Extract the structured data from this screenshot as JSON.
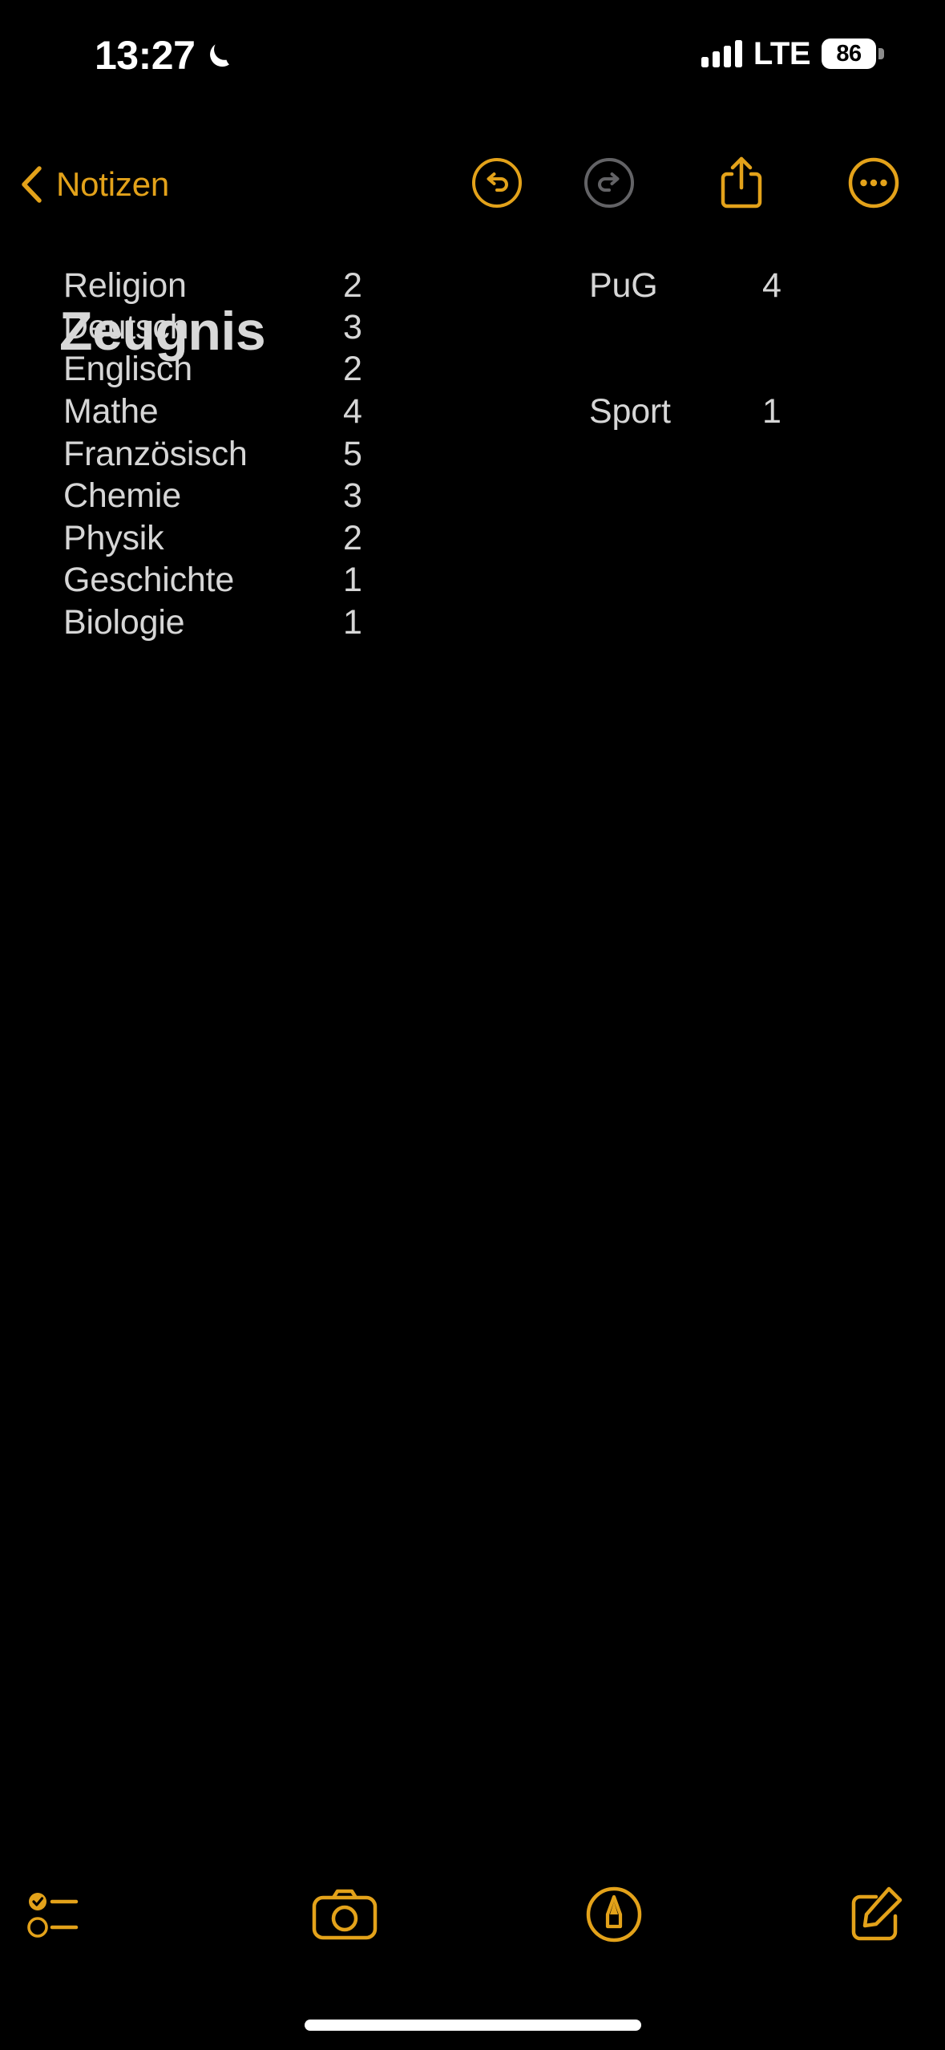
{
  "theme": {
    "background": "#000000",
    "accent": "#e3a21a",
    "text": "#d6d6d6",
    "title_text": "#d8d8d8",
    "disabled": "#636366",
    "status_text": "#ffffff"
  },
  "status_bar": {
    "time": "13:27",
    "dnd_icon": "crescent-moon-icon",
    "signal_icon": "cellular-signal-bars-icon",
    "signal_strength": 4,
    "carrier": "LTE",
    "battery_level": "86",
    "battery_icon": "battery-icon"
  },
  "nav_bar": {
    "back_label": "Notizen",
    "back_icon": "chevron-left-icon",
    "actions": [
      {
        "name": "undo-button",
        "icon": "undo-circle-icon",
        "enabled": true
      },
      {
        "name": "redo-button",
        "icon": "redo-circle-icon",
        "enabled": false
      },
      {
        "name": "share-button",
        "icon": "share-icon",
        "enabled": true
      },
      {
        "name": "more-button",
        "icon": "ellipsis-circle-icon",
        "enabled": true
      }
    ]
  },
  "note": {
    "title": "Zeugnis",
    "columns": [
      {
        "rows": [
          {
            "subject": "Religion",
            "grade": "2"
          },
          {
            "subject": "Deutsch",
            "grade": "3"
          },
          {
            "subject": "Englisch",
            "grade": "2"
          },
          {
            "subject": "Mathe",
            "grade": "4"
          },
          {
            "subject": "Französisch",
            "grade": "5"
          },
          {
            "subject": "Chemie",
            "grade": "3"
          },
          {
            "subject": "Physik",
            "grade": "2"
          },
          {
            "subject": "Geschichte",
            "grade": "1"
          },
          {
            "subject": "Biologie",
            "grade": "1"
          }
        ]
      },
      {
        "rows": [
          {
            "subject": "PuG",
            "grade": "4",
            "line": 0
          },
          {
            "subject": "Sport",
            "grade": "1",
            "line": 3
          }
        ]
      }
    ]
  },
  "bottom_toolbar": {
    "buttons": [
      {
        "name": "checklist-button",
        "icon": "checklist-icon"
      },
      {
        "name": "camera-button",
        "icon": "camera-icon"
      },
      {
        "name": "markup-button",
        "icon": "markup-pen-circle-icon"
      },
      {
        "name": "compose-button",
        "icon": "compose-icon"
      }
    ]
  },
  "home_indicator": {
    "name": "home-indicator"
  }
}
